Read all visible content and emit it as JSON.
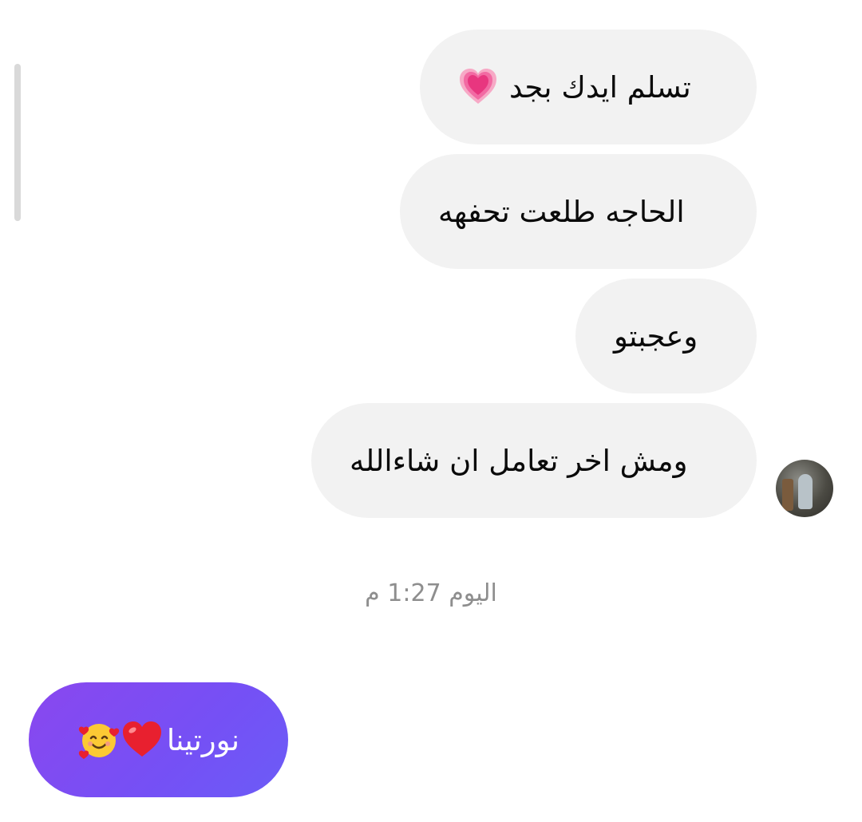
{
  "thread": {
    "received": [
      {
        "text": "تسلم ايدك بجد",
        "emoji": "growing-heart-emoji"
      },
      {
        "text": "الحاجه طلعت تحفهه"
      },
      {
        "text": "وعجبتو"
      },
      {
        "text": "ومش اخر تعامل ان شاءالله"
      }
    ],
    "timestamp": "اليوم 1:27 م",
    "sent": [
      {
        "text": "نورتينا",
        "emojis": [
          "red-heart-emoji",
          "smiling-face-with-hearts-emoji"
        ]
      }
    ]
  },
  "colors": {
    "received_bubble": "#f2f2f2",
    "sent_bubble_start": "#8a47ef",
    "sent_bubble_end": "#6b5cf7",
    "timestamp": "#8e8e8e"
  }
}
